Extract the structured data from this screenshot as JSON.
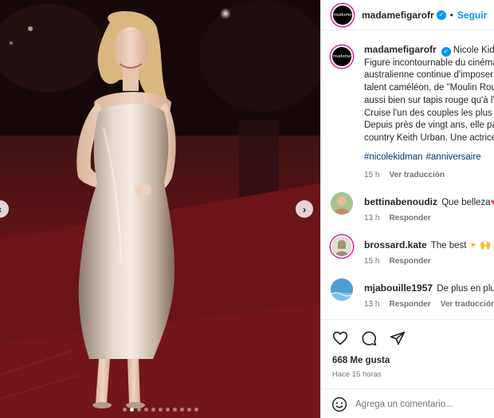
{
  "post": {
    "username": "madamefigarofr",
    "brand_logo_text": "madame",
    "follow_label": "Seguir",
    "separator": "•",
    "caption_lines": [
      "Nicole Kidma",
      "Figure incontournable du cinéma",
      "australienne continue d'imposer",
      "talent caméléon, de \"Moulin Rou",
      "aussi bien sur tapis rouge qu'à l'é",
      "Cruise l'un des couples les plus m",
      "Depuis près de vingt ans, elle par",
      "country Keith Urban. Une actrice"
    ],
    "hashtags": [
      "#nicolekidman",
      "#anniversaire"
    ],
    "caption_time": "15 h",
    "caption_translate": "Ver traducción",
    "likes": "668 Me gusta",
    "time_ago": "Hace 15 horas",
    "add_comment_placeholder": "Agrega un comentario..."
  },
  "comments": [
    {
      "username": "bettinabenoudiz",
      "text": "Que belleza",
      "emoji": "♥",
      "time": "13 h",
      "reply": "Responder",
      "translate": ""
    },
    {
      "username": "brossard.kate",
      "text": "The best",
      "emoji": "☀ 🙌",
      "time": "15 h",
      "reply": "Responder",
      "translate": ""
    },
    {
      "username": "mjabouille1957",
      "text": "De plus en plus b",
      "emoji": "",
      "time": "13 h",
      "reply": "Responder",
      "translate": "Ver traducción"
    }
  ],
  "carousel": {
    "total_slides": 11,
    "active_index": 1
  },
  "colors": {
    "accent": "#0095f6",
    "link": "#00376b",
    "muted": "#737373",
    "heart": "#ed4956",
    "red_carpet": "#6a1418"
  },
  "icons": [
    "verified-badge-icon",
    "heart-icon",
    "comment-icon",
    "share-icon",
    "emoji-icon",
    "chevron-right-icon",
    "chevron-left-icon"
  ]
}
